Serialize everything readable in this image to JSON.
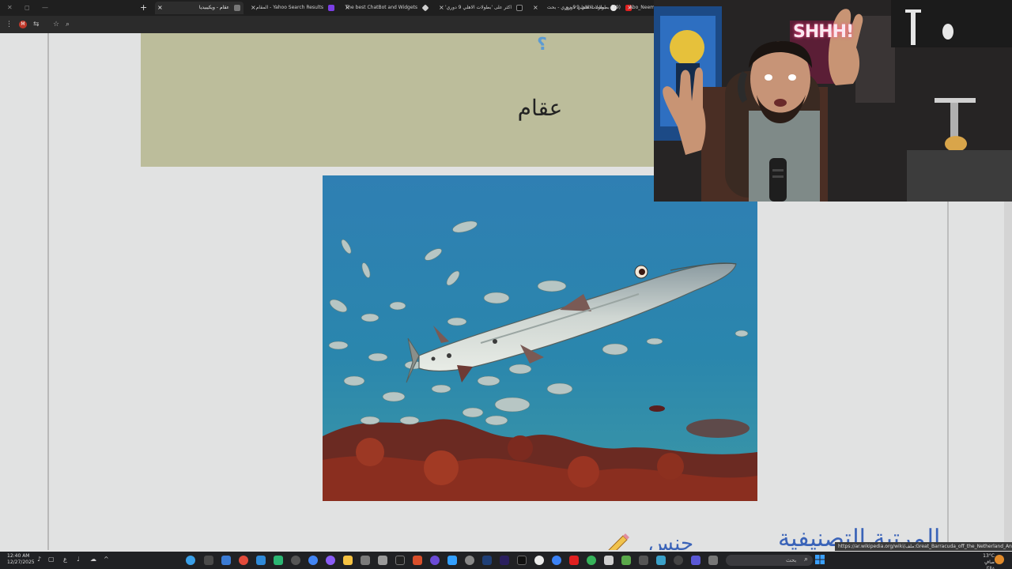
{
  "browser": {
    "tabs": [
      {
        "title": "عقام - ويكيبيديا",
        "active": true
      },
      {
        "title": "Yahoo Search Results - المقام",
        "active": false
      },
      {
        "title": "The best ChatBot and Widgets",
        "active": false
      },
      {
        "title": "اكثر على 'بطولات الاهلي 9 دوري'",
        "active": false
      },
      {
        "title": "بطولات الاهلي 9 دوري - بحث",
        "active": false
      },
      {
        "title": "(39) بطولات الاهلي 9 دوري",
        "active": false
      },
      {
        "title": "Abo_Neem",
        "active": false
      }
    ],
    "new_tab_label": "+",
    "close_glyph": "×",
    "toolbar": {
      "gmail_badge": "M"
    }
  },
  "page": {
    "help_mark": "؟",
    "heading": "عقام",
    "bottom_link_text": "المرتبة التصنيفية",
    "bottom_genus_text": "جنس",
    "accent_color": "#3a63b8"
  },
  "webcam": {
    "sign_text": "SHHH!"
  },
  "status_bar": {
    "url": "https://ar.wikipedia.org/wiki/ملف:Great_Barracuda_off_the_Netherland_Antilles.jpg"
  },
  "taskbar": {
    "time": "12:40 AM",
    "date": "12/27/2025",
    "lang": "ع",
    "search_placeholder": "بحث",
    "weather_temp": "13°C",
    "weather_desc": "صافٍ غالبًا"
  }
}
